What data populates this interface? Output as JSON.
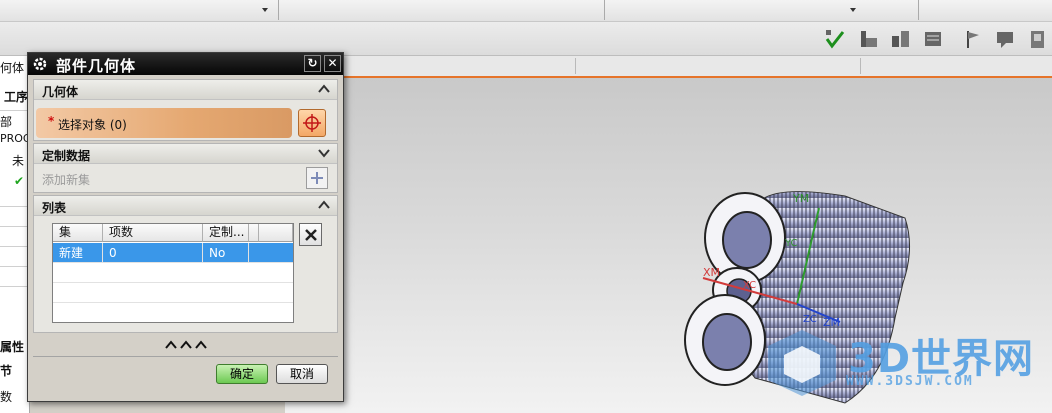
{
  "navigator": {
    "labels": [
      "何体",
      "工序",
      "部",
      "PROG",
      "未",
      "属性",
      "节",
      "数"
    ]
  },
  "dialog": {
    "title": "部件几何体",
    "geometry_group": {
      "label": "几何体",
      "select_object_label": "选择对象 (0)",
      "required_marker": "*"
    },
    "custom_data_group": {
      "label": "定制数据",
      "add_set_label": "添加新集"
    },
    "list_group": {
      "label": "列表",
      "columns": [
        "集",
        "项数",
        "定制..."
      ],
      "rows": [
        {
          "set": "新建",
          "count": "0",
          "custom": "No"
        }
      ]
    },
    "ok_label": "确定",
    "cancel_label": "取消"
  },
  "viewport": {
    "axis_labels": {
      "ym": "YM",
      "yc": "YC",
      "xm": "XM",
      "xc": "XC",
      "zc": "ZC",
      "zm": "ZM"
    }
  },
  "watermark": {
    "text": "3D世界网",
    "url": "WWW.3DSJW.COM"
  },
  "colors": {
    "accent_orange": "#e6742a",
    "selection_blue": "#3a97e9",
    "ok_green": "#6cc952",
    "watermark_blue": "#54a0e2"
  }
}
